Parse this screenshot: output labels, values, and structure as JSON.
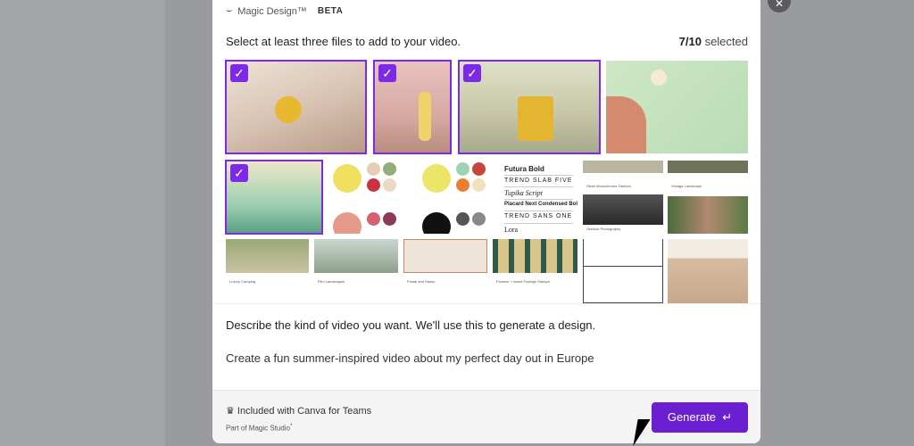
{
  "header": {
    "title": "Magic Design™",
    "badge": "BETA"
  },
  "selection": {
    "prompt": "Select at least three files to add to your video.",
    "count": "7/10",
    "count_suffix": " selected"
  },
  "fonts": [
    "Futura Bold",
    "TREND SLAB FIVE",
    "Tupika Script",
    "Placard Next Condensed Bold",
    "TREND SANS ONE",
    "Lora"
  ],
  "captions": {
    "street": "Sleek Monochrome Fashion",
    "outdoor": "Outdoor Photography",
    "vintage": "Vintage Landscape",
    "luxury": "Luxury Camping",
    "film": "Film Landscapes",
    "postal": "Postal and Stamp",
    "flowers": "Flowers + Insect Postage Stamps"
  },
  "description": {
    "label": "Describe the kind of video you want. We'll use this to generate a design.",
    "value": "Create a fun summer-inspired video about my perfect day out in Europe"
  },
  "footer": {
    "included": "Included with Canva for Teams",
    "part_of": "Part of Magic Studio",
    "generate": "Generate"
  },
  "colors": {
    "accent": "#7d2ae8",
    "button": "#6a1fd1"
  }
}
